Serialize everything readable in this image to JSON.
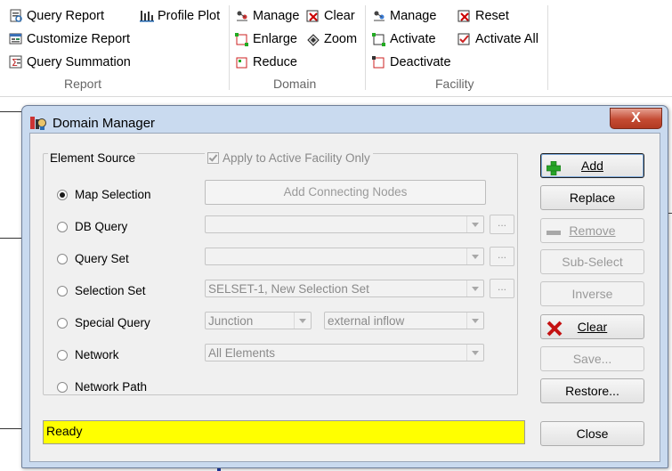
{
  "ribbon": {
    "report": {
      "items": [
        "Query Report",
        "Customize Report",
        "Query Summation",
        "Profile Plot"
      ],
      "label": "Report"
    },
    "domain": {
      "items": [
        "Manage",
        "Clear",
        "Enlarge",
        "Zoom",
        "Reduce"
      ],
      "label": "Domain"
    },
    "facility": {
      "items": [
        "Manage",
        "Reset",
        "Activate",
        "Activate All",
        "Deactivate"
      ],
      "label": "Facility"
    }
  },
  "dialog": {
    "title": "Domain Manager",
    "close_glyph": "X",
    "element_source": {
      "legend": "Element Source",
      "apply_label": "Apply to Active Facility Only",
      "apply_checked": true,
      "options": [
        {
          "label": "Map Selection",
          "selected": true
        },
        {
          "label": "DB Query",
          "selected": false
        },
        {
          "label": "Query Set",
          "selected": false
        },
        {
          "label": "Selection Set",
          "selected": false
        },
        {
          "label": "Special Query",
          "selected": false
        },
        {
          "label": "Network",
          "selected": false
        },
        {
          "label": "Network Path",
          "selected": false
        }
      ],
      "add_connecting_nodes": "Add Connecting Nodes",
      "db_query_value": "",
      "query_set_value": "",
      "selection_set_value": "SELSET-1, New Selection Set",
      "special_query_type": "Junction",
      "special_query_value": "external inflow",
      "network_value": "All Elements",
      "ellipsis": "..."
    },
    "status_text": "Ready",
    "status_color": "#ffff00",
    "buttons": {
      "add": "Add",
      "replace": "Replace",
      "remove": "Remove",
      "sub_select": "Sub-Select",
      "inverse": "Inverse",
      "clear": "Clear",
      "save": "Save...",
      "restore": "Restore...",
      "close": "Close"
    }
  }
}
